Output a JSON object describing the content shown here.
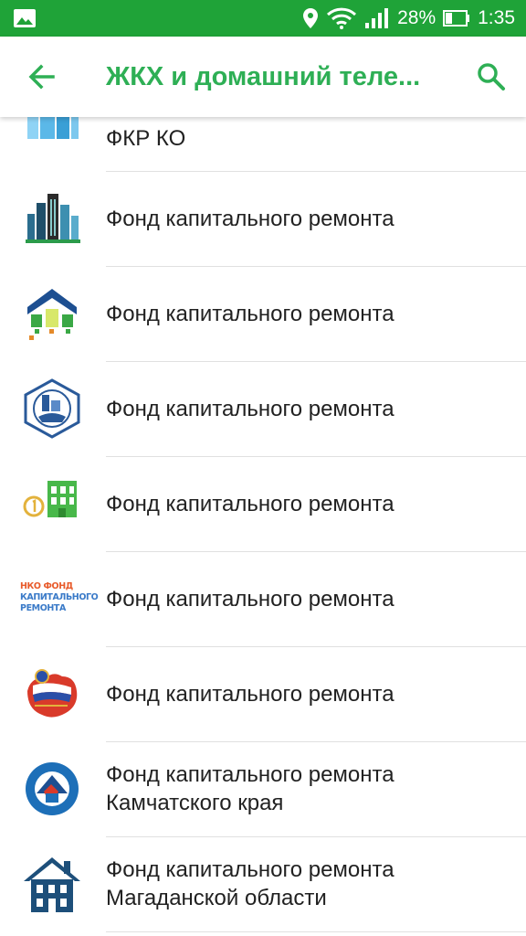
{
  "status_bar": {
    "battery": "28%",
    "time": "1:35"
  },
  "app_bar": {
    "title": "ЖКХ и домашний теле..."
  },
  "items": [
    {
      "line1": "ФКР КО",
      "line2": ""
    },
    {
      "line1": "Фонд капитального ремонта",
      "line2": ""
    },
    {
      "line1": "Фонд капитального ремонта",
      "line2": ""
    },
    {
      "line1": "Фонд капитального ремонта",
      "line2": ""
    },
    {
      "line1": "Фонд капитального ремонта",
      "line2": ""
    },
    {
      "line1": "Фонд капитального ремонта",
      "line2": "",
      "logo_text": [
        "НКО ФОНД",
        "КАПИТАЛЬНОГО",
        "РЕМОНТА"
      ]
    },
    {
      "line1": "Фонд капитального ремонта",
      "line2": ""
    },
    {
      "line1": "Фонд капитального ремонта",
      "line2": "Камчатского края"
    },
    {
      "line1": "Фонд капитального ремонта",
      "line2": "Магаданской области"
    }
  ],
  "colors": {
    "status_bar": "#1fa338",
    "accent": "#2eaf55",
    "divider": "#e0e0e0"
  },
  "icons": {
    "status": [
      "image-icon",
      "location-icon",
      "wifi-icon",
      "signal-icon",
      "battery-icon"
    ],
    "app_bar": [
      "back-arrow-icon",
      "search-icon"
    ]
  }
}
